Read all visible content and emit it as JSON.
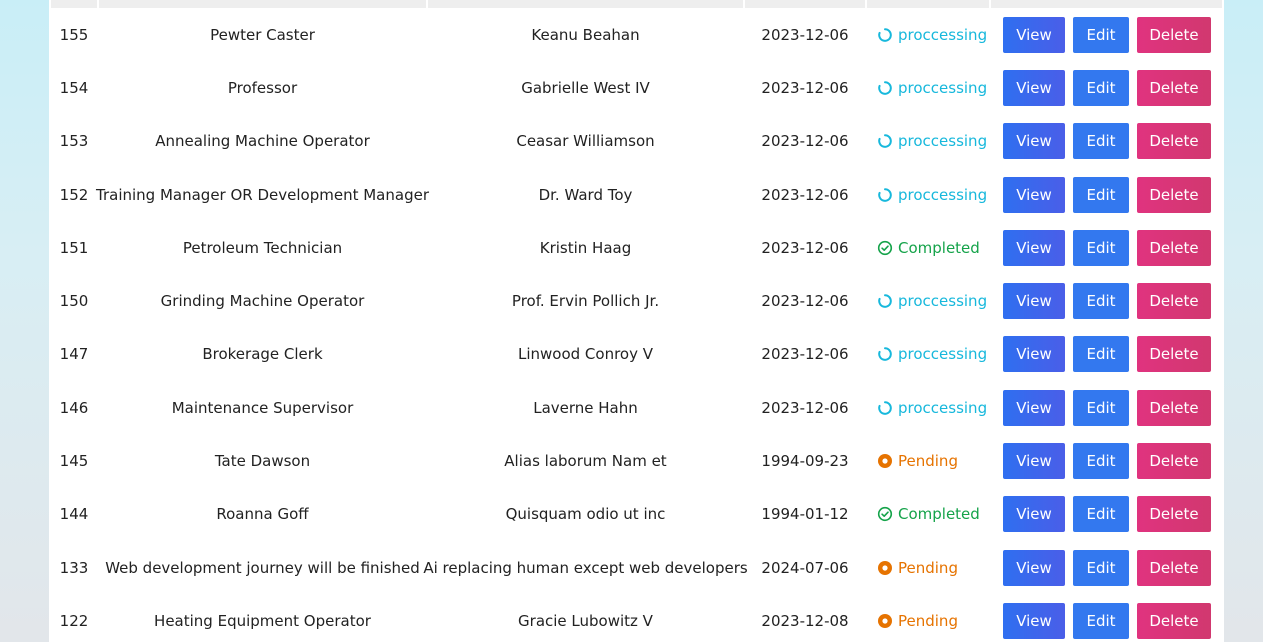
{
  "table": {
    "rows": [
      {
        "id": "155",
        "title": "Pewter Caster",
        "name": "Keanu Beahan",
        "date": "2023-12-06",
        "status": "proccessing",
        "status_type": "processing"
      },
      {
        "id": "154",
        "title": "Professor",
        "name": "Gabrielle West IV",
        "date": "2023-12-06",
        "status": "proccessing",
        "status_type": "processing"
      },
      {
        "id": "153",
        "title": "Annealing Machine Operator",
        "name": "Ceasar Williamson",
        "date": "2023-12-06",
        "status": "proccessing",
        "status_type": "processing"
      },
      {
        "id": "152",
        "title": "Training Manager OR Development Manager",
        "name": "Dr. Ward Toy",
        "date": "2023-12-06",
        "status": "proccessing",
        "status_type": "processing"
      },
      {
        "id": "151",
        "title": "Petroleum Technician",
        "name": "Kristin Haag",
        "date": "2023-12-06",
        "status": "Completed",
        "status_type": "completed"
      },
      {
        "id": "150",
        "title": "Grinding Machine Operator",
        "name": "Prof. Ervin Pollich Jr.",
        "date": "2023-12-06",
        "status": "proccessing",
        "status_type": "processing"
      },
      {
        "id": "147",
        "title": "Brokerage Clerk",
        "name": "Linwood Conroy V",
        "date": "2023-12-06",
        "status": "proccessing",
        "status_type": "processing"
      },
      {
        "id": "146",
        "title": "Maintenance Supervisor",
        "name": "Laverne Hahn",
        "date": "2023-12-06",
        "status": "proccessing",
        "status_type": "processing"
      },
      {
        "id": "145",
        "title": "Tate Dawson",
        "name": "Alias laborum Nam et",
        "date": "1994-09-23",
        "status": "Pending",
        "status_type": "pending"
      },
      {
        "id": "144",
        "title": "Roanna Goff",
        "name": "Quisquam odio ut inc",
        "date": "1994-01-12",
        "status": "Completed",
        "status_type": "completed"
      },
      {
        "id": "133",
        "title": "Web development journey will be finished",
        "name": "Ai replacing human except web developers",
        "date": "2024-07-06",
        "status": "Pending",
        "status_type": "pending"
      },
      {
        "id": "122",
        "title": "Heating Equipment Operator",
        "name": "Gracie Lubowitz V",
        "date": "2023-12-08",
        "status": "Pending",
        "status_type": "pending"
      }
    ],
    "actions": {
      "view_label": "View",
      "edit_label": "Edit",
      "delete_label": "Delete"
    }
  },
  "colors": {
    "processing": "#17b8dc",
    "completed": "#15a34a",
    "pending": "#e67300",
    "view_button": "#2f6ff0",
    "edit_button": "#3378ef",
    "delete_button": "#e0337f"
  },
  "icons": {
    "processing": "spinner-icon",
    "completed": "check-circle-icon",
    "pending": "dot-circle-icon"
  }
}
